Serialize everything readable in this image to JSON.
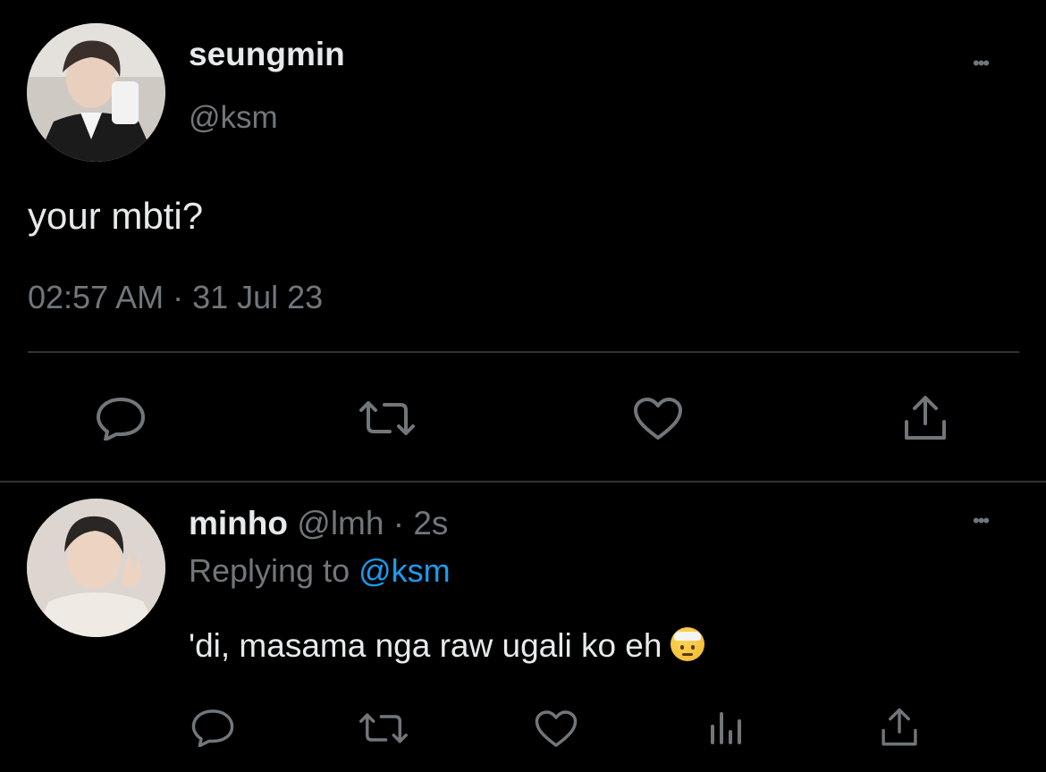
{
  "tweet": {
    "author_name": "seungmin",
    "author_handle": "@ksm",
    "text": "your mbti?",
    "timestamp": "02:57 AM · 31 Jul 23",
    "more_glyph": "•••"
  },
  "reply": {
    "author_name": "minho",
    "author_handle": "@lmh",
    "time_ago": "· 2s",
    "replying_prefix": "Replying to",
    "replying_handle": "@ksm",
    "text": "'di, masama nga raw ugali ko eh",
    "emoji": "face-with-head-bandage",
    "more_glyph": "•••"
  },
  "colors": {
    "background": "#000000",
    "text": "#e7e9ea",
    "muted": "#71767b",
    "link": "#1d9bf0",
    "divider": "#2f3336"
  },
  "icons": {
    "reply": "reply-icon",
    "retweet": "retweet-icon",
    "like": "like-icon",
    "share": "share-icon",
    "views": "views-icon",
    "more": "more-icon"
  }
}
